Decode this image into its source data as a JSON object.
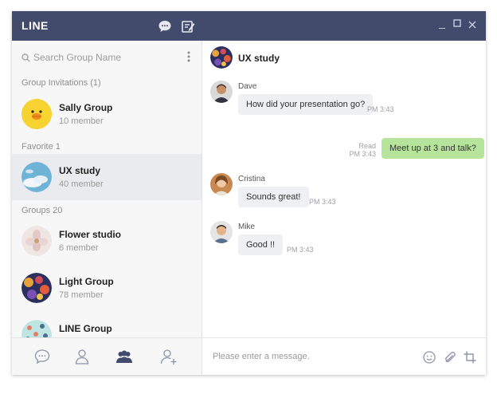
{
  "app": {
    "name": "LINE",
    "accent": "#424b6b",
    "bubble_mine": "#b6e49a"
  },
  "titlebar": {
    "icons": [
      "chat-bubble-icon",
      "compose-icon"
    ],
    "window_controls": {
      "minimize": "_",
      "maximize": "☐",
      "close": "✕"
    }
  },
  "left": {
    "search_placeholder": "Search Group Name",
    "sections": {
      "invitations": "Group Invitations (1)",
      "favorite": "Favorite 1",
      "groups": "Groups 20"
    },
    "items": [
      {
        "name": "Sally Group",
        "sub": "10 member"
      },
      {
        "name": "UX study",
        "sub": "40 member"
      },
      {
        "name": "Flower studio",
        "sub": "6 member"
      },
      {
        "name": "Light Group",
        "sub": "78 member"
      },
      {
        "name": "LINE Group",
        "sub": ""
      }
    ],
    "bottom_icons": [
      "chat-icon",
      "friend-icon",
      "group-icon",
      "add-friend-icon"
    ]
  },
  "chat": {
    "title": "UX study",
    "messages": [
      {
        "sender": "Dave",
        "text": "How did your presentation go?",
        "time": "PM 3:43"
      },
      {
        "sender": "",
        "text": "Meet up at 3 and talk?",
        "read": "Read",
        "time": "PM 3:43"
      },
      {
        "sender": "Cristina",
        "text": "Sounds great!",
        "time": "PM 3:43"
      },
      {
        "sender": "Mike",
        "text": "Good !!",
        "time": "PM 3:43"
      }
    ],
    "composer_placeholder": "Please enter a message.",
    "composer_icons": [
      "emoji-icon",
      "attach-icon",
      "crop-icon"
    ]
  }
}
